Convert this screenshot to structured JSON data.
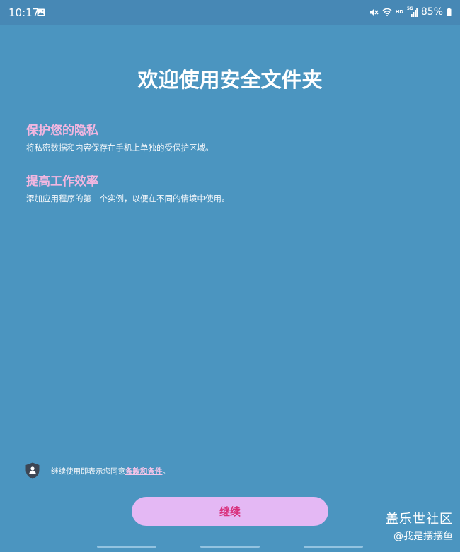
{
  "status_bar": {
    "time": "10:17",
    "battery": "85%",
    "icons": [
      "gallery-icon",
      "mute-icon",
      "wifi-icon",
      "hd-icon",
      "signal-5g-icon",
      "battery-icon"
    ],
    "hd_label": "HD",
    "net_label": "5G"
  },
  "main": {
    "title": "欢迎使用安全文件夹",
    "features": [
      {
        "title": "保护您的隐私",
        "description": "将私密数据和内容保存在手机上单独的受保护区域。"
      },
      {
        "title": "提高工作效率",
        "description": "添加应用程序的第二个实例，以便在不同的情境中使用。"
      }
    ]
  },
  "footer": {
    "terms_prefix": "继续使用即表示您同意",
    "terms_link": "条款和条件",
    "terms_suffix": "。",
    "continue_label": "继续"
  },
  "watermark": {
    "line1": "盖乐世社区",
    "line2": "@我是摆摆鱼"
  },
  "colors": {
    "background": "#4b95c0",
    "accent_pink": "#f2b6e0",
    "button_bg": "#e4b8f4",
    "button_text": "#d9307c"
  }
}
